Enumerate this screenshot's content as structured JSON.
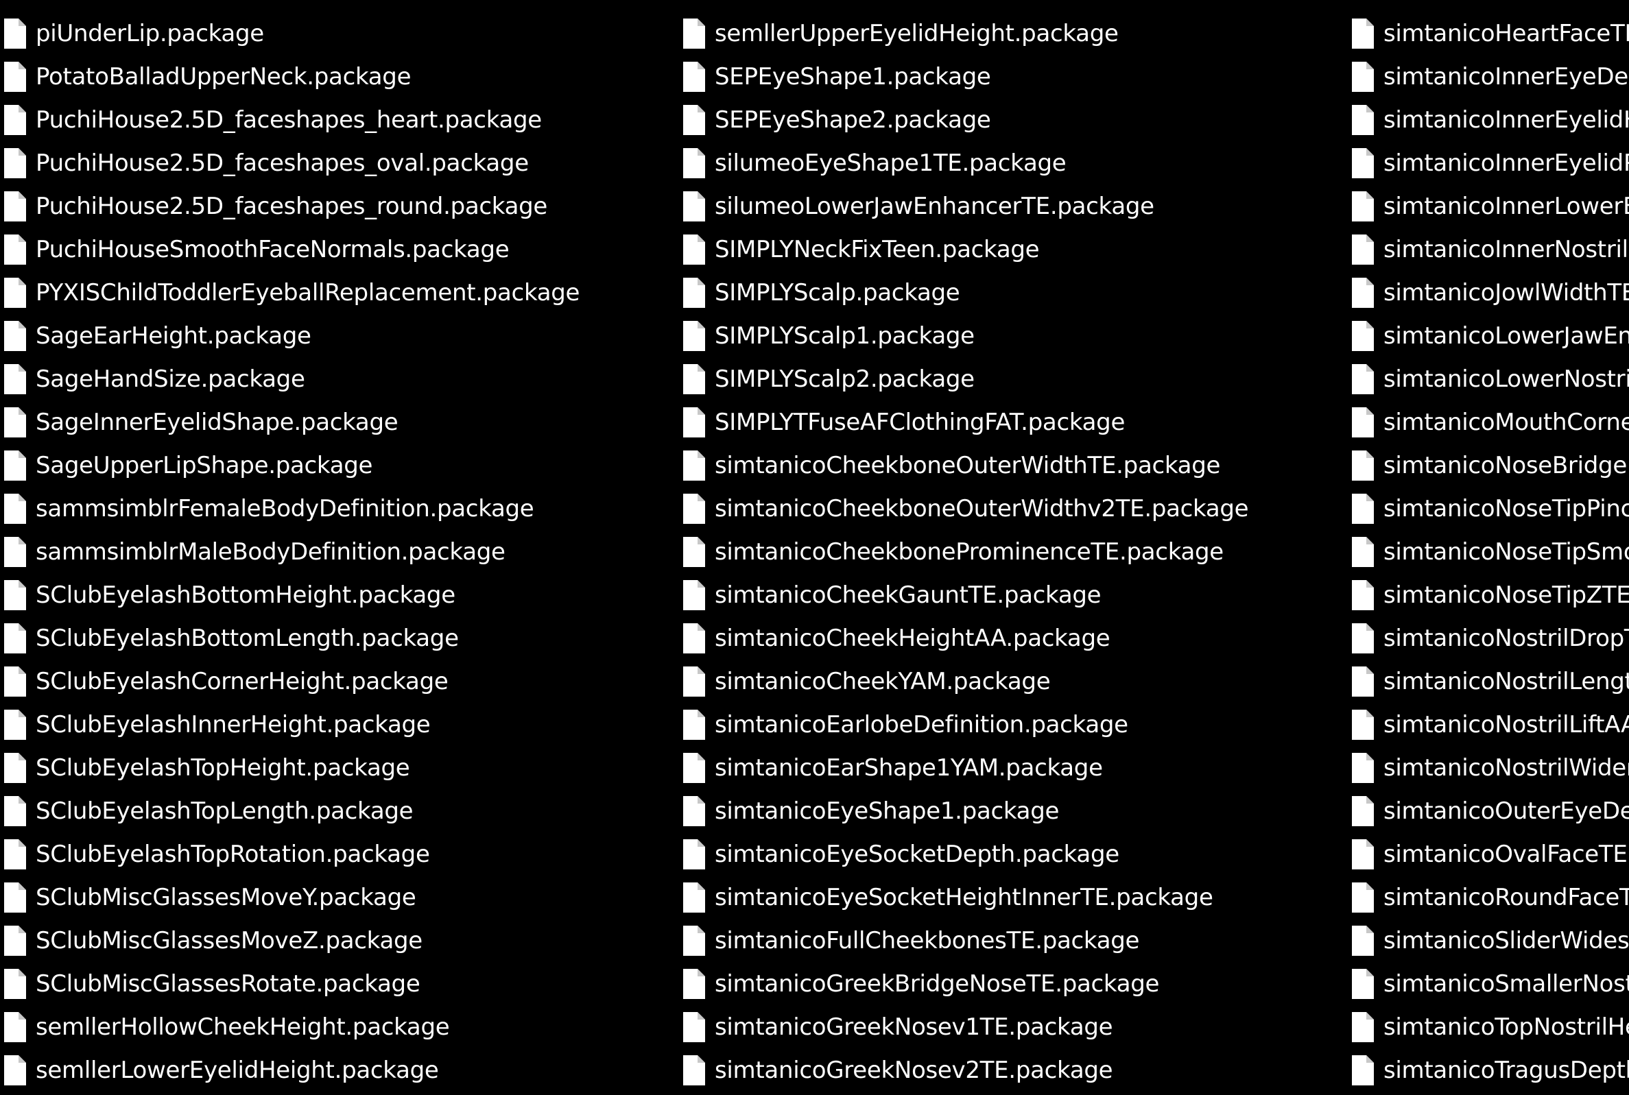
{
  "theme": {
    "background": "#000000",
    "text_color": "#ffffff",
    "icon_fill": "#ffffff",
    "icon_fold": "#c8c8c8"
  },
  "file_icon": "document-file-icon",
  "columns": [
    {
      "files": [
        "piUnderLip.package",
        "PotatoBalladUpperNeck.package",
        "PuchiHouse2.5D_faceshapes_heart.package",
        "PuchiHouse2.5D_faceshapes_oval.package",
        "PuchiHouse2.5D_faceshapes_round.package",
        "PuchiHouseSmoothFaceNormals.package",
        "PYXISChildToddlerEyeballReplacement.package",
        "SageEarHeight.package",
        "SageHandSize.package",
        "SageInnerEyelidShape.package",
        "SageUpperLipShape.package",
        "sammsimblrFemaleBodyDefinition.package",
        "sammsimblrMaleBodyDefinition.package",
        "SClubEyelashBottomHeight.package",
        "SClubEyelashBottomLength.package",
        "SClubEyelashCornerHeight.package",
        "SClubEyelashInnerHeight.package",
        "SClubEyelashTopHeight.package",
        "SClubEyelashTopLength.package",
        "SClubEyelashTopRotation.package",
        "SClubMiscGlassesMoveY.package",
        "SClubMiscGlassesMoveZ.package",
        "SClubMiscGlassesRotate.package",
        "semllerHollowCheekHeight.package",
        "semllerLowerEyelidHeight.package"
      ]
    },
    {
      "files": [
        "semllerUpperEyelidHeight.package",
        "SEPEyeShape1.package",
        "SEPEyeShape2.package",
        "silumeoEyeShape1TE.package",
        "silumeoLowerJawEnhancerTE.package",
        "SIMPLYNeckFixTeen.package",
        "SIMPLYScalp.package",
        "SIMPLYScalp1.package",
        "SIMPLYScalp2.package",
        "SIMPLYTFuseAFClothingFAT.package",
        "simtanicoCheekboneOuterWidthTE.package",
        "simtanicoCheekboneOuterWidthv2TE.package",
        "simtanicoCheekboneProminenceTE.package",
        "simtanicoCheekGauntTE.package",
        "simtanicoCheekHeightAA.package",
        "simtanicoCheekYAM.package",
        "simtanicoEarlobeDefinition.package",
        "simtanicoEarShape1YAM.package",
        "simtanicoEyeShape1.package",
        "simtanicoEyeSocketDepth.package",
        "simtanicoEyeSocketHeightInnerTE.package",
        "simtanicoFullCheekbonesTE.package",
        "simtanicoGreekBridgeNoseTE.package",
        "simtanicoGreekNosev1TE.package",
        "simtanicoGreekNosev2TE.package"
      ]
    },
    {
      "files": [
        "simtanicoHeartFaceTE",
        "simtanicoInnerEyeDep",
        "simtanicoInnerEyelidH",
        "simtanicoInnerEyelidP",
        "simtanicoInnerLowerE",
        "simtanicoInnerNostrilD",
        "simtanicoJowlWidthTE",
        "simtanicoLowerJawEnh",
        "simtanicoLowerNostril",
        "simtanicoMouthCorne",
        "simtanicoNoseBridgeN",
        "simtanicoNoseTipPinc",
        "simtanicoNoseTipSmo",
        "simtanicoNoseTipZTE.",
        "simtanicoNostrilDropT",
        "simtanicoNostrilLengt",
        "simtanicoNostrilLiftAA",
        "simtanicoNostrilWiden",
        "simtanicoOuterEyeDep",
        "simtanicoOvalFaceTE.p",
        "simtanicoRoundFaceTE",
        "simtanicoSliderWidese",
        "simtanicoSmallerNostr",
        "simtanicoTopNostrilHe",
        "simtanicoTragusDepth"
      ]
    }
  ]
}
